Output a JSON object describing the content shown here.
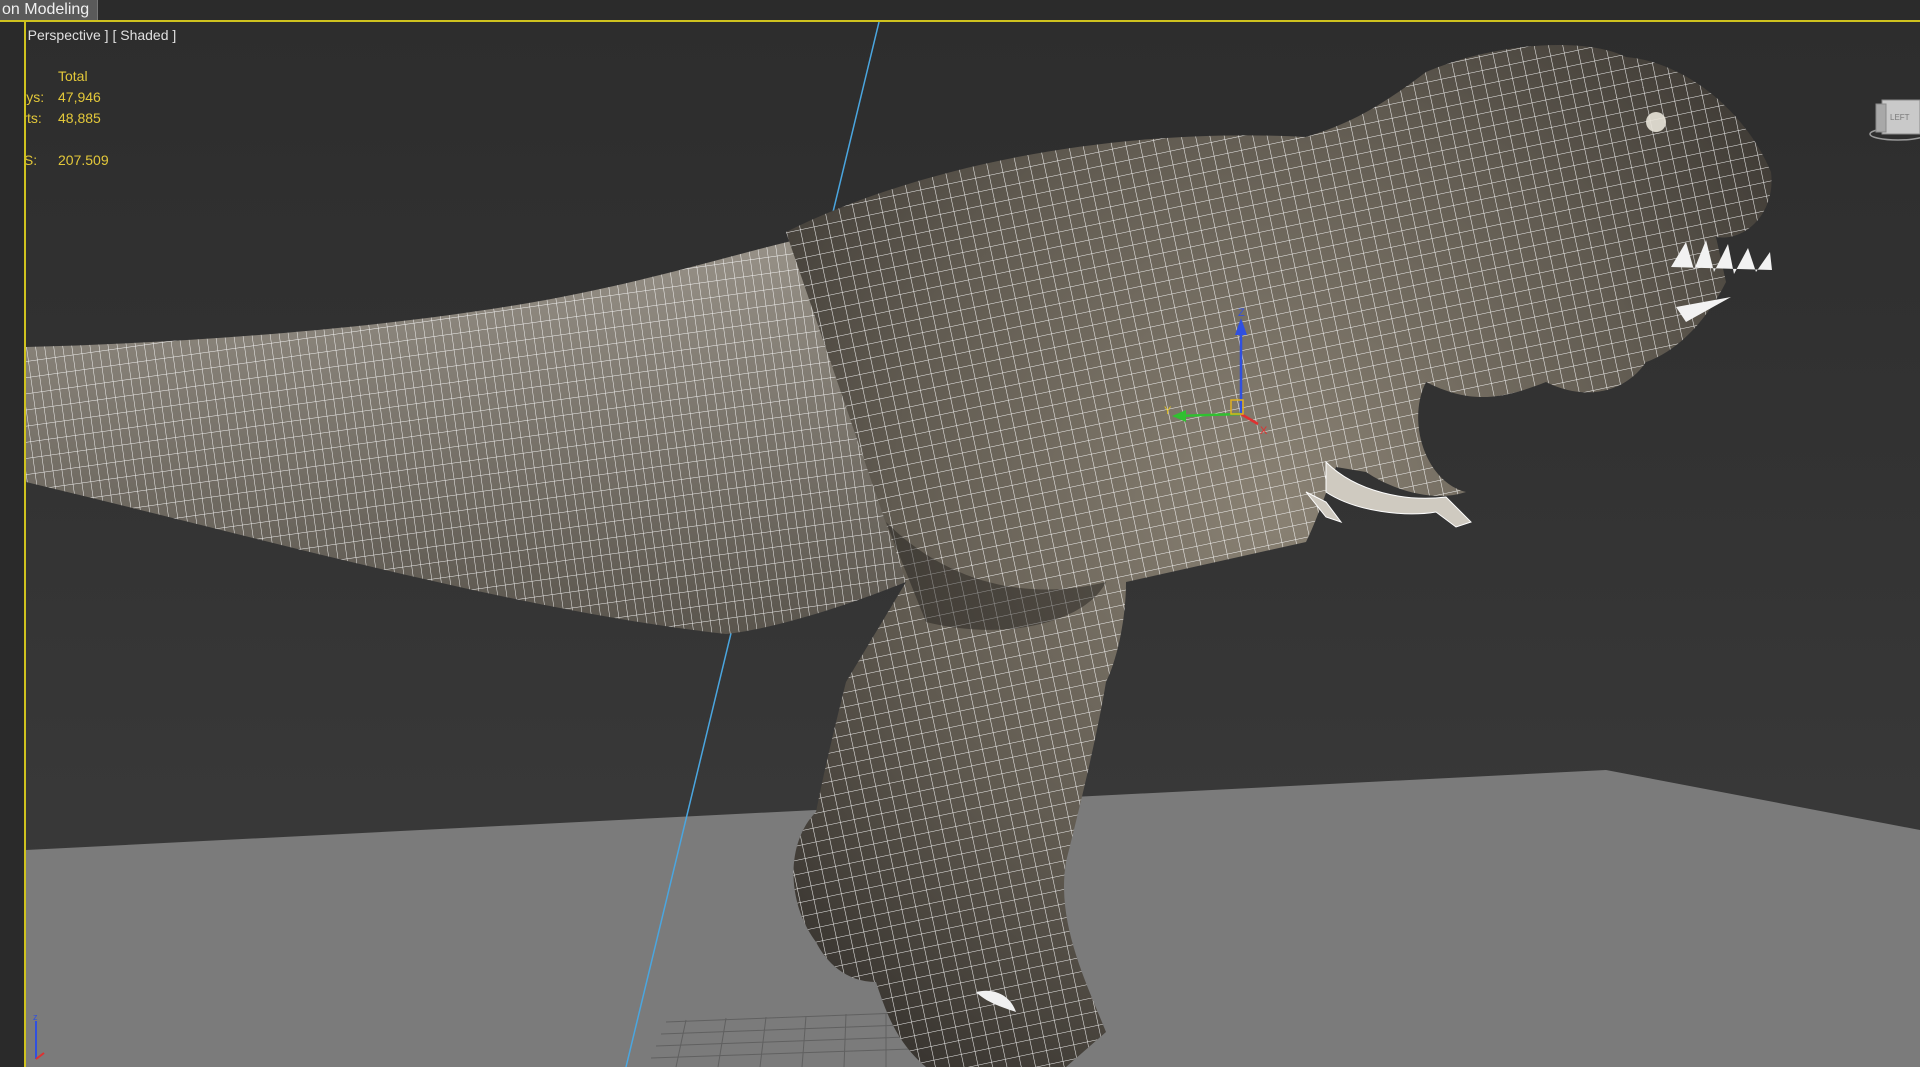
{
  "ribbon": {
    "active_tab": "on Modeling"
  },
  "viewport": {
    "label": {
      "menu": "+ ]",
      "view": "[ Perspective ]",
      "shading": "[ Shaded ]"
    },
    "stats": {
      "header": "Total",
      "rows": [
        {
          "key": "Polys:",
          "value": "47,946"
        },
        {
          "key": "Verts:",
          "value": "48,885"
        }
      ],
      "fps": {
        "key": "FPS:",
        "value": "207.509"
      }
    },
    "gizmo_axes": {
      "x": "X",
      "y": "Y",
      "z": "Z"
    },
    "viewcube_label": "LEFT"
  },
  "colors": {
    "accent": "#cfc21f",
    "stats_text": "#e3c83a",
    "wire": "#ffffff",
    "ground": "#7b7b7b",
    "axis_x": "#e03030",
    "axis_y": "#30c030",
    "axis_z": "#3050e0",
    "guide_line": "#4aa6e0"
  },
  "icons": {
    "viewcube": "viewcube-icon",
    "tripod": "axis-tripod-icon",
    "gizmo": "transform-gizmo-icon"
  }
}
